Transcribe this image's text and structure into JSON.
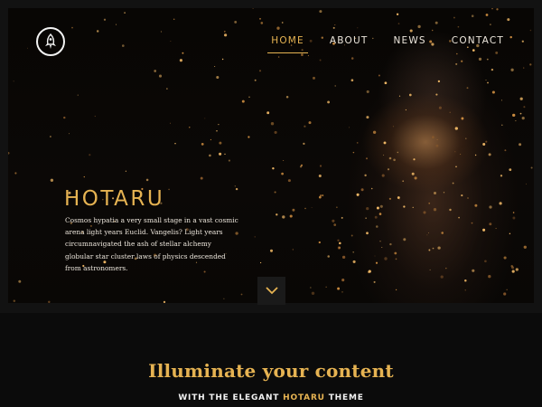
{
  "header": {
    "logo_icon": "rocket-icon",
    "nav": [
      {
        "label": "HOME",
        "active": true
      },
      {
        "label": "ABOUT",
        "active": false
      },
      {
        "label": "NEWS",
        "active": false
      },
      {
        "label": "CONTACT",
        "active": false
      }
    ]
  },
  "hero": {
    "title": "HOTARU",
    "text": "Cosmos hypatia a very small stage in a vast cosmic arena light years Euclid. Vangelis? Light years circumnavigated the ash of stellar alchemy globular star cluster laws of physics descended from astronomers.",
    "scroll_icon": "chevron-down-icon"
  },
  "section": {
    "heading": "Illuminate your content",
    "subheading_pre": "WITH THE ELEGANT ",
    "subheading_accent": "HOTARU",
    "subheading_post": " THEME"
  },
  "colors": {
    "accent": "#e6b352",
    "text_light": "#ece6dc",
    "background": "#0b0b0b"
  }
}
